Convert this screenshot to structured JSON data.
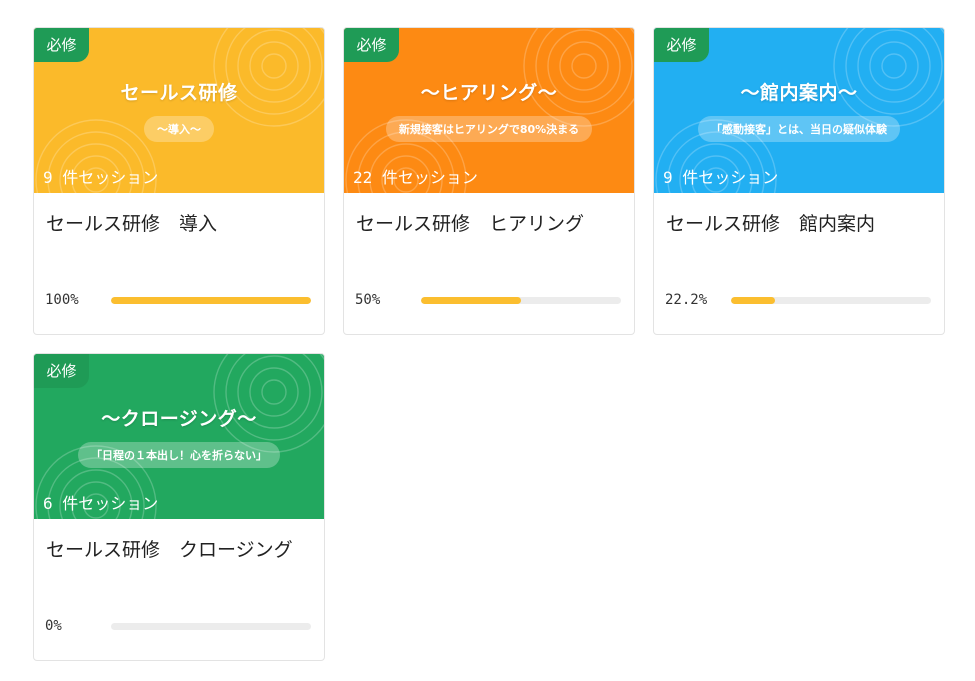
{
  "courses": [
    {
      "badge": "必修",
      "banner_title": "セールス研修",
      "banner_subtitle": "〜導入〜",
      "sessions": "9 件セッション",
      "title": "セールス研修　導入",
      "progress_label": "100%",
      "progress_fraction": 1.0,
      "color": "#fbba2a"
    },
    {
      "badge": "必修",
      "banner_title": "〜ヒアリング〜",
      "banner_subtitle": "新規接客はヒアリングで80%決まる",
      "sessions": "22 件セッション",
      "title": "セールス研修　ヒアリング",
      "progress_label": "50%",
      "progress_fraction": 0.5,
      "color": "#fd8a13"
    },
    {
      "badge": "必修",
      "banner_title": "〜館内案内〜",
      "banner_subtitle": "「感動接客」とは、当日の疑似体験",
      "sessions": "9 件セッション",
      "title": "セールス研修　館内案内",
      "progress_label": "22.2%",
      "progress_fraction": 0.222,
      "color": "#22aff2"
    },
    {
      "badge": "必修",
      "banner_title": "〜クロージング〜",
      "banner_subtitle": "「日程の１本出し！心を折らない」",
      "sessions": "6 件セッション",
      "title": "セールス研修　クロージング",
      "progress_label": "0%",
      "progress_fraction": 0,
      "color": "#22a85f"
    }
  ],
  "progress_color": "#fbbe2f",
  "badge_color": "#1f9b56"
}
